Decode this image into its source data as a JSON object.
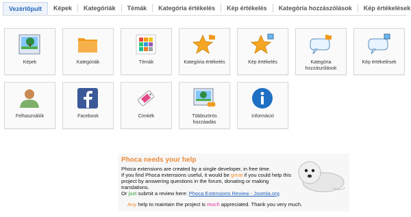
{
  "tabs": [
    {
      "label": "Vezérlőpult",
      "active": true
    },
    {
      "label": "Képek"
    },
    {
      "label": "Kategóriák"
    },
    {
      "label": "Témák"
    },
    {
      "label": "Kategória értékelés"
    },
    {
      "label": "Kép értékelés"
    },
    {
      "label": "Kategória hozzászólások"
    },
    {
      "label": "Kép értékelések"
    }
  ],
  "tiles": [
    {
      "label": "Képek",
      "icon": "image-icon"
    },
    {
      "label": "Kategóriák",
      "icon": "folder-icon"
    },
    {
      "label": "Témák",
      "icon": "theme-icon"
    },
    {
      "label": "Kategória értékelés",
      "icon": "star-folder-icon"
    },
    {
      "label": "Kép értékelés",
      "icon": "star-image-icon"
    },
    {
      "label": "Kategória hozzászólások",
      "icon": "comment-folder-icon"
    },
    {
      "label": "Kép értékelések",
      "icon": "comment-image-icon"
    },
    {
      "label": "Felhasználók",
      "icon": "user-icon"
    },
    {
      "label": "Facebook",
      "icon": "facebook-icon"
    },
    {
      "label": "Címkék",
      "icon": "tag-icon"
    },
    {
      "label": "Többszörös hozzáadás",
      "icon": "multiple-add-icon"
    },
    {
      "label": "Információ",
      "icon": "info-icon"
    }
  ],
  "help": {
    "title": "Phoca needs your help",
    "p1": "Phoca extensions are created by a single developer, in free time.",
    "p2a": "If you find Phoca extensions useful, it would be ",
    "p2b": "great",
    "p2c": " if you could help this project by answering questions in the forum, donating or making translations.",
    "p3a": "Or ",
    "p3b": "just",
    "p3c": " submit a review here: ",
    "link": "Phoca Extensions Review - Joomla.org",
    "f1": "Any",
    "f2": " help to maintain the project is ",
    "f3": "much",
    "f4": " appreciated. Thank you very much."
  },
  "colors": {
    "accent": "#2a6ab8",
    "help_title": "#e98b3b",
    "star": "#f5a623",
    "facebook": "#3b5998",
    "info": "#1f6fc4"
  }
}
